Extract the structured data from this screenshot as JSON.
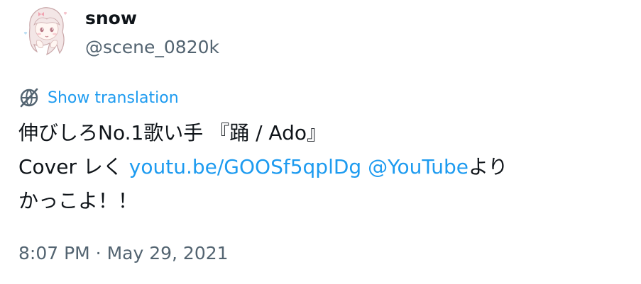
{
  "author": {
    "display_name": "snow",
    "handle": "@scene_0820k",
    "avatar_icon": "anime-avatar-icon"
  },
  "translate": {
    "icon": "translate-icon",
    "label": "Show translation",
    "color": "#1d9bf0"
  },
  "tweet": {
    "line1": "伸びしろNo.1歌い手 『踊 / Ado』",
    "line2_prefix": "Cover レく ",
    "link_url": "youtu.be/GOOSf5qplDg",
    "space": " ",
    "mention": "@YouTube",
    "line2_suffix": "より",
    "line3": "かっこよ！！"
  },
  "meta": {
    "time": "8:07 PM",
    "separator": " · ",
    "date": "May 29, 2021"
  },
  "colors": {
    "text": "#0f1419",
    "secondary": "#536471",
    "accent": "#1d9bf0"
  }
}
